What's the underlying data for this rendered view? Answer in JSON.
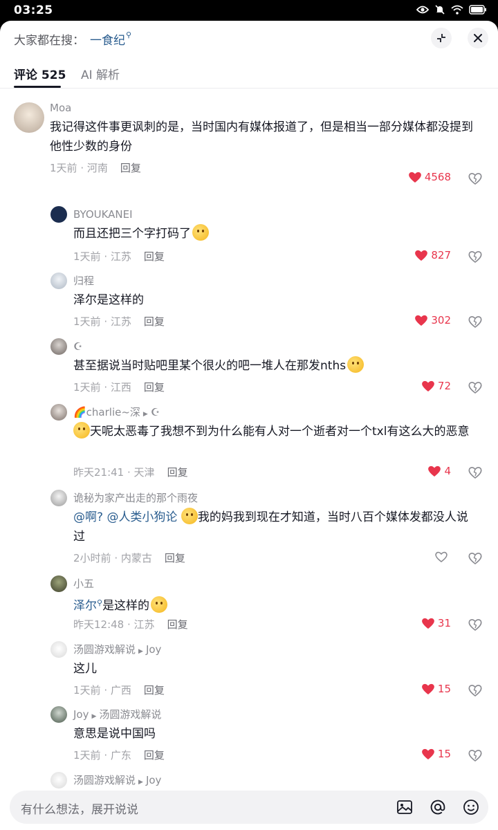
{
  "status": {
    "time": "03:25"
  },
  "search": {
    "prefix": "大家都在搜：",
    "term": "一食纪",
    "mark": "⚲"
  },
  "tabs": {
    "comments": "评论 525",
    "ai": "AI 解析"
  },
  "comments": [
    {
      "user": "Moa",
      "text": "我记得这件事更讽刺的是，当时国内有媒体报道了，但是相当一部分媒体都没提到他性少数的身份",
      "time": "1天前",
      "location": "河南",
      "reply": "回复",
      "likes": "4568",
      "liked": true
    },
    {
      "user": "BYOUKANEI",
      "text": "而且还把三个字打码了",
      "time": "1天前",
      "location": "江苏",
      "reply": "回复",
      "likes": "827",
      "liked": true
    },
    {
      "user": "归程",
      "text": "泽尔是这样的",
      "time": "1天前",
      "location": "江苏",
      "reply": "回复",
      "likes": "302",
      "liked": true
    },
    {
      "user": "☪",
      "text": "甚至据说当时贴吧里某个很火的吧一堆人在那发nths",
      "time": "1天前",
      "location": "江西",
      "reply": "回复",
      "likes": "72",
      "liked": true
    },
    {
      "user": "🌈charlie~深",
      "reply_to": "☪",
      "text": "天呢太恶毒了我想不到为什么能有人对一个逝者对一个txl有这么大的恶意",
      "time": "昨天21:41",
      "location": "天津",
      "reply": "回复",
      "likes": "4",
      "liked": true
    },
    {
      "user": "诡秘为家产出走的那个雨夜",
      "mention1": "@啊?",
      "mention2": "@人类小狗论",
      "text": "我的妈我到现在才知道，当时八百个媒体发都没人说过",
      "time": "2小时前",
      "location": "内蒙古",
      "reply": "回复",
      "likes": "",
      "liked": false
    },
    {
      "user": "小五",
      "mention": "泽尔",
      "text": "是这样的",
      "time": "昨天12:48",
      "location": "江苏",
      "reply": "回复",
      "likes": "31",
      "liked": true
    },
    {
      "user": "汤圆游戏解说",
      "reply_to": "Joy",
      "text": "这儿",
      "time": "1天前",
      "location": "广西",
      "reply": "回复",
      "likes": "15",
      "liked": true
    },
    {
      "user": "Joy",
      "reply_to": "汤圆游戏解说",
      "text": "意思是说中国吗",
      "time": "1天前",
      "location": "广东",
      "reply": "回复",
      "likes": "15",
      "liked": true
    },
    {
      "user": "汤圆游戏解说",
      "reply_to": "Joy",
      "text": "✔️"
    }
  ],
  "input": {
    "placeholder": "有什么想法，展开说说"
  },
  "colors": {
    "accent": "#2a5d8f",
    "like": "#e8354c",
    "text": "#161823",
    "muted": "#a1a2a7"
  }
}
